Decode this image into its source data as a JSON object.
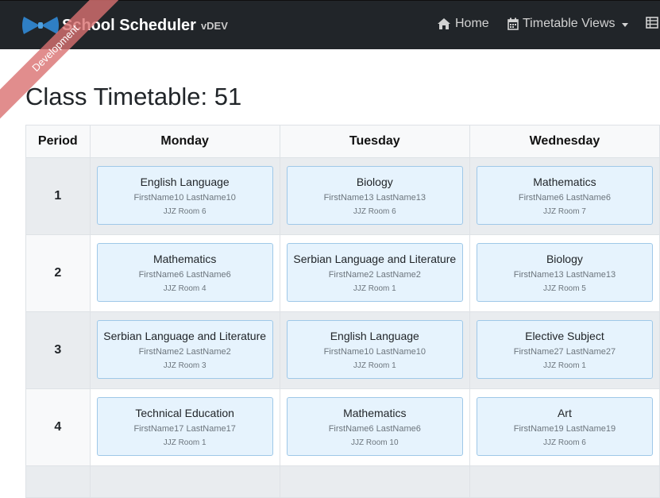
{
  "navbar": {
    "brand": "School Scheduler",
    "version": "vDEV",
    "links": {
      "home": "Home",
      "timetable_views": "Timetable Views"
    },
    "icons": {
      "home": "home-icon",
      "views": "calendar-icon",
      "extra": "table-icon"
    },
    "background": "#212529"
  },
  "ribbon": {
    "label": "Development",
    "color": "#d97070"
  },
  "page": {
    "title": "Class Timetable: 51"
  },
  "timetable": {
    "headers": [
      "Period",
      "Monday",
      "Tuesday",
      "Wednesday"
    ],
    "rows": [
      {
        "period": "1",
        "lessons": [
          {
            "subject": "English Language",
            "teacher": "FirstName10 LastName10",
            "room": "JJZ Room 6"
          },
          {
            "subject": "Biology",
            "teacher": "FirstName13 LastName13",
            "room": "JJZ Room 6"
          },
          {
            "subject": "Mathematics",
            "teacher": "FirstName6 LastName6",
            "room": "JJZ Room 7"
          }
        ]
      },
      {
        "period": "2",
        "lessons": [
          {
            "subject": "Mathematics",
            "teacher": "FirstName6 LastName6",
            "room": "JJZ Room 4"
          },
          {
            "subject": "Serbian Language and Literature",
            "teacher": "FirstName2 LastName2",
            "room": "JJZ Room 1"
          },
          {
            "subject": "Biology",
            "teacher": "FirstName13 LastName13",
            "room": "JJZ Room 5"
          }
        ]
      },
      {
        "period": "3",
        "lessons": [
          {
            "subject": "Serbian Language and Literature",
            "teacher": "FirstName2 LastName2",
            "room": "JJZ Room 3"
          },
          {
            "subject": "English Language",
            "teacher": "FirstName10 LastName10",
            "room": "JJZ Room 1"
          },
          {
            "subject": "Elective Subject",
            "teacher": "FirstName27 LastName27",
            "room": "JJZ Room 1"
          }
        ]
      },
      {
        "period": "4",
        "lessons": [
          {
            "subject": "Technical Education",
            "teacher": "FirstName17 LastName17",
            "room": "JJZ Room 1"
          },
          {
            "subject": "Mathematics",
            "teacher": "FirstName6 LastName6",
            "room": "JJZ Room 10"
          },
          {
            "subject": "Art",
            "teacher": "FirstName19 LastName19",
            "room": "JJZ Room 6"
          }
        ]
      }
    ]
  }
}
